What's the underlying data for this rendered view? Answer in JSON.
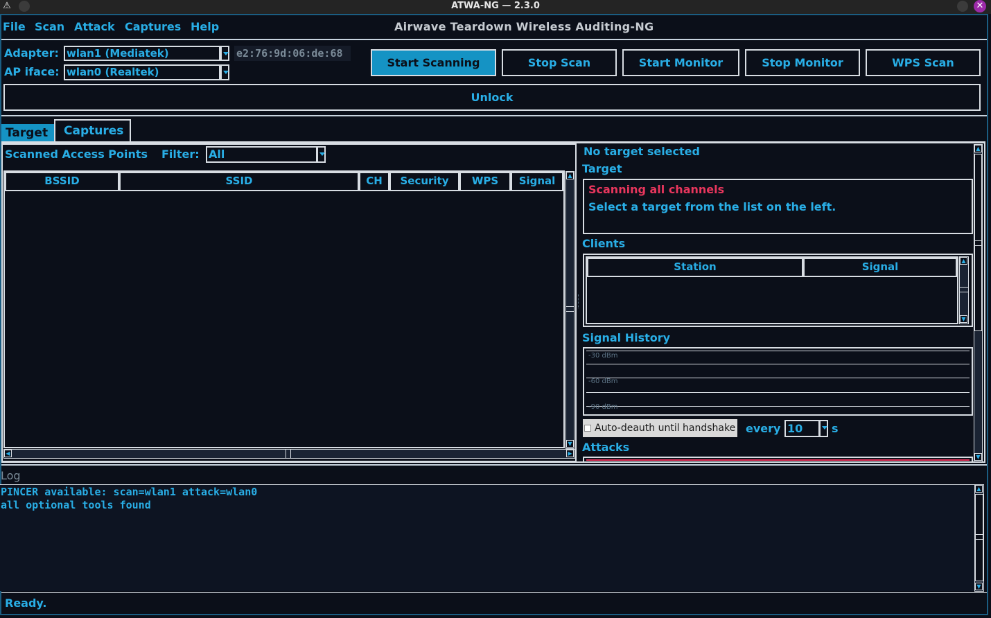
{
  "window": {
    "title": "ATWA-NG — 2.3.0"
  },
  "menu": {
    "items": [
      "File",
      "Scan",
      "Attack",
      "Captures",
      "Help"
    ],
    "app_title": "Airwave Teardown Wireless Auditing-NG"
  },
  "adapter": {
    "label": "Adapter:",
    "value": "wlan1 (Mediatek)",
    "mac": "e2:76:9d:06:de:68"
  },
  "ap_iface": {
    "label": "AP iface:",
    "value": "wlan0 (Realtek)"
  },
  "toolbar": {
    "start_scanning": "Start Scanning",
    "stop_scan": "Stop Scan",
    "start_monitor": "Start Monitor",
    "stop_monitor": "Stop Monitor",
    "wps_scan": "WPS Scan",
    "unlock": "Unlock"
  },
  "tabs": [
    "Target",
    "Captures"
  ],
  "scan": {
    "title": "Scanned Access Points",
    "filter_label": "Filter:",
    "filter_value": "All",
    "columns": [
      "BSSID",
      "SSID",
      "CH",
      "Security",
      "WPS",
      "Signal"
    ]
  },
  "target": {
    "header": "No target selected",
    "section_label": "Target",
    "status": "Scanning all channels",
    "hint": "Select a target from the list on the left."
  },
  "clients": {
    "label": "Clients",
    "columns": [
      "Station",
      "Signal"
    ]
  },
  "signal_history": {
    "label": "Signal History",
    "ticks": [
      "-30 dBm",
      "-60 dBm",
      "-90 dBm"
    ]
  },
  "deauth": {
    "checkbox_label": "Auto-deauth until handshake",
    "every_label": "every",
    "interval": "10",
    "unit": "s"
  },
  "attacks": {
    "label": "Attacks"
  },
  "log": {
    "label": "Log",
    "lines": [
      "PINCER available: scan=wlan1 attack=wlan0",
      "all optional tools found"
    ]
  },
  "status": {
    "text": "Ready."
  },
  "colors": {
    "accent": "#29aee6",
    "alert": "#e8365d",
    "background": "#0b0f19",
    "active_button": "#1593c4"
  }
}
